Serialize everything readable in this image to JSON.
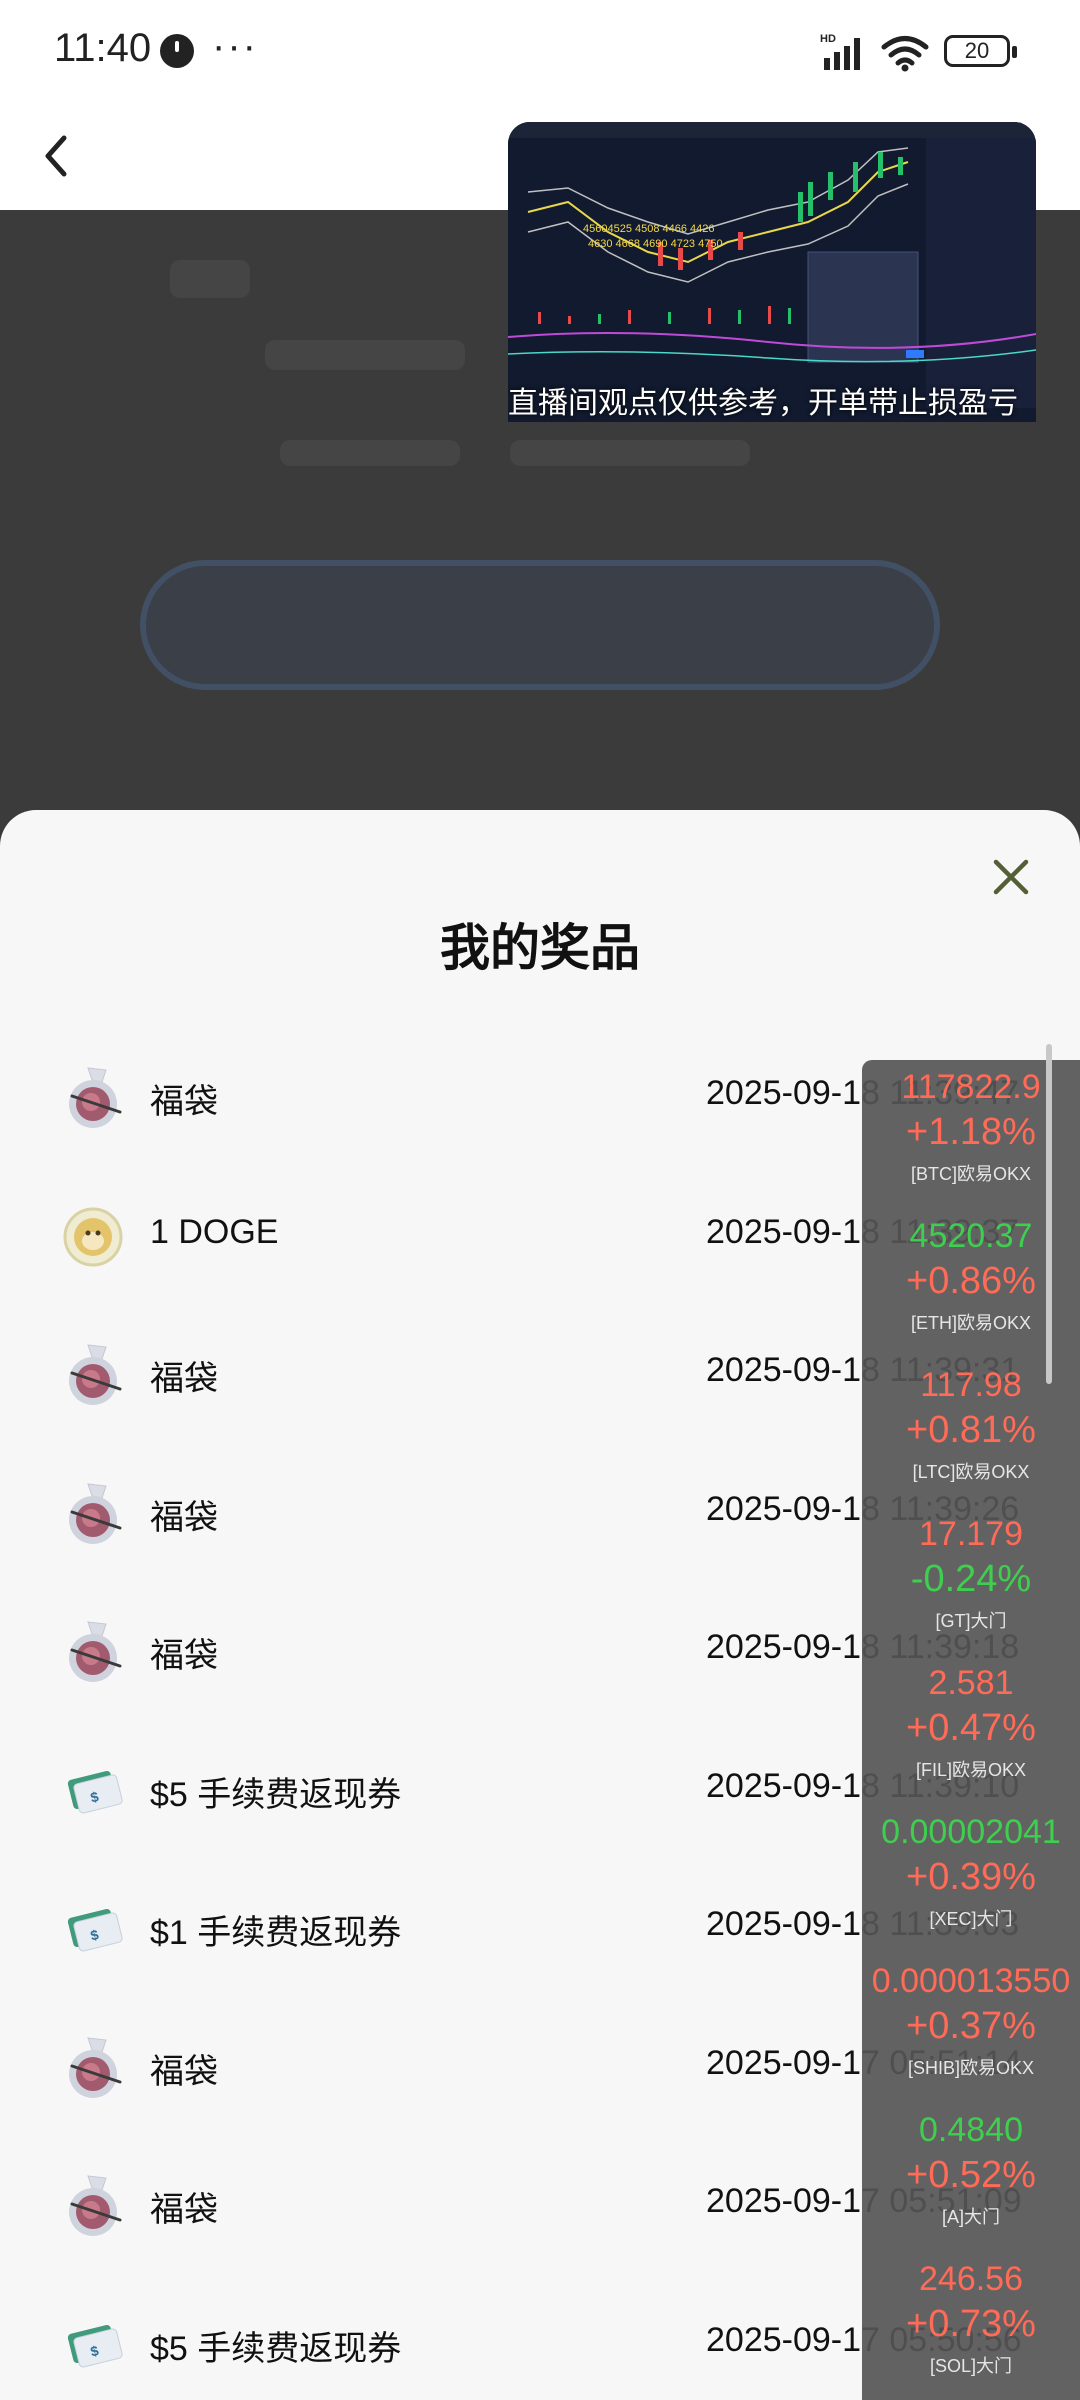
{
  "status_bar": {
    "time": "11:40",
    "more": "···",
    "network": "HD",
    "battery": "20"
  },
  "live": {
    "caption": "直播间观点仅供参考，开单带止损盈亏",
    "chart_numbers": "45604525  4508  4466  4426",
    "chart_numbers_2": "4630  4668  4690  4723  4750"
  },
  "sheet": {
    "title": "我的奖品"
  },
  "prizes": [
    {
      "name": "福袋",
      "time": "2025-09-18 11:39:47",
      "icon": "lucky-bag-icon"
    },
    {
      "name": "1 DOGE",
      "time": "2025-09-18 11:39:37",
      "icon": "doge-coin-icon"
    },
    {
      "name": "福袋",
      "time": "2025-09-18 11:39:31",
      "icon": "lucky-bag-icon"
    },
    {
      "name": "福袋",
      "time": "2025-09-18 11:39:26",
      "icon": "lucky-bag-icon"
    },
    {
      "name": "福袋",
      "time": "2025-09-18 11:39:18",
      "icon": "lucky-bag-icon"
    },
    {
      "name": "$5 手续费返现券",
      "time": "2025-09-18 11:39:10",
      "icon": "cashback-voucher-icon"
    },
    {
      "name": "$1 手续费返现券",
      "time": "2025-09-18 11:39:03",
      "icon": "cashback-voucher-icon"
    },
    {
      "name": "福袋",
      "time": "2025-09-17 05:51:14",
      "icon": "lucky-bag-icon"
    },
    {
      "name": "福袋",
      "time": "2025-09-17 05:51:09",
      "icon": "lucky-bag-icon"
    },
    {
      "name": "$5 手续费返现券",
      "time": "2025-09-17 05:50:56",
      "icon": "cashback-voucher-icon"
    }
  ],
  "tickers": [
    {
      "price": "117822.9",
      "change": "+1.18%",
      "label": "[BTC]欧易OKX",
      "price_color": "#ff6b57",
      "change_color": "#ff6b57"
    },
    {
      "price": "4520.37",
      "change": "+0.86%",
      "label": "[ETH]欧易OKX",
      "price_color": "#3fcf4f",
      "change_color": "#ff6b57"
    },
    {
      "price": "117.98",
      "change": "+0.81%",
      "label": "[LTC]欧易OKX",
      "price_color": "#ff6b57",
      "change_color": "#ff6b57"
    },
    {
      "price": "17.179",
      "change": "-0.24%",
      "label": "[GT]大门",
      "price_color": "#ff6b57",
      "change_color": "#3fcf4f"
    },
    {
      "price": "2.581",
      "change": "+0.47%",
      "label": "[FIL]欧易OKX",
      "price_color": "#ff6b57",
      "change_color": "#ff6b57"
    },
    {
      "price": "0.00002041",
      "change": "+0.39%",
      "label": "[XEC]大门",
      "price_color": "#3fcf4f",
      "change_color": "#ff6b57"
    },
    {
      "price": "0.000013550",
      "change": "+0.37%",
      "label": "[SHIB]欧易OKX",
      "price_color": "#ff6b57",
      "change_color": "#ff6b57"
    },
    {
      "price": "0.4840",
      "change": "+0.52%",
      "label": "[A]大门",
      "price_color": "#3fcf4f",
      "change_color": "#ff6b57"
    },
    {
      "price": "246.56",
      "change": "+0.73%",
      "label": "[SOL]大门",
      "price_color": "#ff6b57",
      "change_color": "#ff6b57"
    }
  ]
}
